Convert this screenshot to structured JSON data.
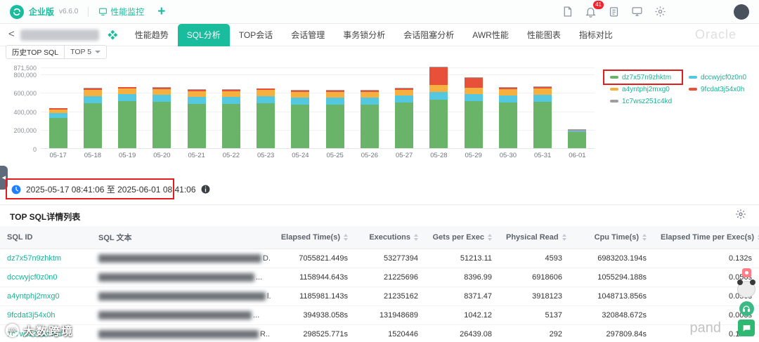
{
  "header": {
    "edition_label": "企业版",
    "version": "v6.6.0",
    "monitor_nav_label": "性能监控",
    "add_label": "+",
    "notification_count": "41"
  },
  "tabbar": {
    "back_label": "<",
    "tabs": [
      "性能趋势",
      "SQL分析",
      "TOP会话",
      "会话管理",
      "事务锁分析",
      "会话阻塞分析",
      "AWR性能",
      "性能图表",
      "指标对比"
    ],
    "active_tab": "SQL分析",
    "right_watermark": "Oracle"
  },
  "chart_section": {
    "title": "历史TOP SQL",
    "top_filter": "TOP 5"
  },
  "chart_data": {
    "type": "bar",
    "stacked": true,
    "title": "历史TOP SQL",
    "categories": [
      "05-17",
      "05-18",
      "05-19",
      "05-20",
      "05-21",
      "05-22",
      "05-23",
      "05-24",
      "05-25",
      "05-26",
      "05-27",
      "05-28",
      "05-29",
      "05-30",
      "05-31",
      "06-01"
    ],
    "series": [
      {
        "name": "dz7x57n9zhktm",
        "color": "#69b469",
        "values": [
          320000,
          480000,
          500000,
          495000,
          470000,
          470000,
          480000,
          465000,
          465000,
          465000,
          485000,
          520000,
          500000,
          490000,
          495000,
          170000
        ]
      },
      {
        "name": "dccwyjcf0z0n0",
        "color": "#53c8e0",
        "values": [
          55000,
          75000,
          75000,
          75000,
          75000,
          80000,
          75000,
          75000,
          75000,
          75000,
          75000,
          85000,
          80000,
          75000,
          80000,
          10000
        ]
      },
      {
        "name": "a4yntphj2mxg0",
        "color": "#f5b03f",
        "values": [
          40000,
          70000,
          60000,
          60000,
          65000,
          60000,
          65000,
          60000,
          60000,
          60000,
          65000,
          70000,
          65000,
          65000,
          65000,
          0
        ]
      },
      {
        "name": "9fcdat3j54x0h",
        "color": "#e8503a",
        "values": [
          12000,
          15000,
          15000,
          15000,
          15000,
          15000,
          15000,
          15000,
          15000,
          15000,
          15000,
          190000,
          105000,
          15000,
          15000,
          0
        ]
      },
      {
        "name": "1c7wsz251c4kd",
        "color": "#9e9e9e",
        "values": [
          3000,
          5000,
          5000,
          5000,
          5000,
          5000,
          5000,
          5000,
          5000,
          5000,
          5000,
          6000,
          5000,
          5000,
          5000,
          25000
        ]
      }
    ],
    "ylim": [
      0,
      871500
    ],
    "yticks": [
      {
        "v": 0,
        "label": "0"
      },
      {
        "v": 200000,
        "label": "200,000"
      },
      {
        "v": 400000,
        "label": "400,000"
      },
      {
        "v": 600000,
        "label": "600,000"
      },
      {
        "v": 800000,
        "label": "800,000"
      },
      {
        "v": 871500,
        "label": "871,500"
      }
    ],
    "legend_position": "right",
    "grid": true
  },
  "daterange": {
    "text": "2025-05-17 08:41:06 至 2025-06-01 08:41:06"
  },
  "table": {
    "title": "TOP SQL详情列表",
    "columns": [
      {
        "label": "SQL ID",
        "sortable": false,
        "align": "left"
      },
      {
        "label": "SQL 文本",
        "sortable": false,
        "align": "left"
      },
      {
        "label": "Elapsed Time(s)",
        "sortable": true,
        "align": "right"
      },
      {
        "label": "Executions",
        "sortable": true,
        "align": "right"
      },
      {
        "label": "Gets per Exec",
        "sortable": true,
        "align": "right"
      },
      {
        "label": "Physical Read",
        "sortable": true,
        "align": "right"
      },
      {
        "label": "Cpu Time(s)",
        "sortable": true,
        "align": "right"
      },
      {
        "label": "Elapsed Time per Exec(s)",
        "sortable": true,
        "align": "right"
      }
    ],
    "rows": [
      {
        "sql_id": "dz7x57n9zhktm",
        "sql_text_tail": "D...",
        "elapsed": "7055821.449s",
        "executions": "53277394",
        "gets_per_exec": "51213.11",
        "physical_read": "4593",
        "cpu_time": "6983203.194s",
        "elapsed_per_exec": "0.132s"
      },
      {
        "sql_id": "dccwyjcf0z0n0",
        "sql_text_tail": "...",
        "elapsed": "1158944.643s",
        "executions": "21225696",
        "gets_per_exec": "8396.99",
        "physical_read": "6918606",
        "cpu_time": "1055294.188s",
        "elapsed_per_exec": "0.056s"
      },
      {
        "sql_id": "a4yntphj2mxg0",
        "sql_text_tail": "l...",
        "elapsed": "1185981.143s",
        "executions": "21235162",
        "gets_per_exec": "8371.47",
        "physical_read": "3918123",
        "cpu_time": "1048713.856s",
        "elapsed_per_exec": "0.056s"
      },
      {
        "sql_id": "9fcdat3j54x0h",
        "sql_text_tail": "...",
        "elapsed": "394938.058s",
        "executions": "131948689",
        "gets_per_exec": "1042.12",
        "physical_read": "5137",
        "cpu_time": "320848.672s",
        "elapsed_per_exec": "0.003s"
      },
      {
        "sql_id": "1c7wsz251c4kd",
        "sql_text_tail": "R...",
        "elapsed": "298525.771s",
        "executions": "1520446",
        "gets_per_exec": "26439.08",
        "physical_read": "292",
        "cpu_time": "297809.84s",
        "elapsed_per_exec": "0.196s"
      }
    ]
  },
  "watermarks": {
    "bottom_left": "大数跨境",
    "bottom_left_logo": "100",
    "bottom_right": "pand"
  },
  "colors": {
    "accent": "#19bc9c",
    "link": "#17b392",
    "annotation": "#e11d1d"
  }
}
